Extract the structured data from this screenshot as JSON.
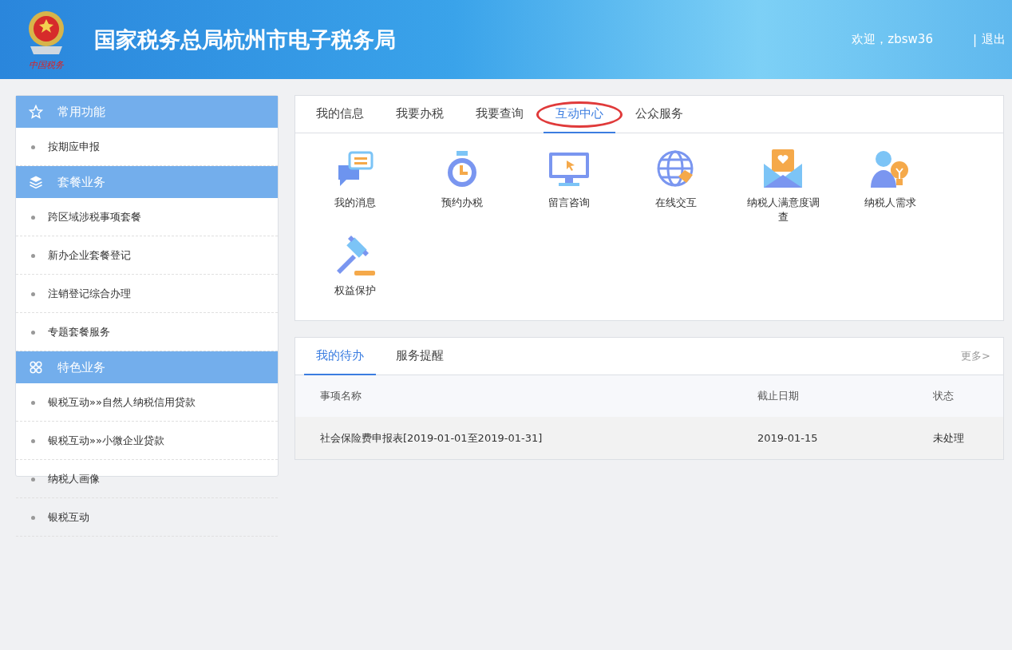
{
  "header": {
    "logo_text": "中国税务",
    "title": "国家税务总局杭州市电子税务局",
    "welcome": "欢迎，zbsw36",
    "separator": "|",
    "logout": "退出"
  },
  "sidebar": {
    "groups": [
      {
        "kind": "star",
        "title": "常用功能",
        "items": [
          "按期应申报"
        ]
      },
      {
        "kind": "layers",
        "title": "套餐业务",
        "items": [
          "跨区域涉税事项套餐",
          "新办企业套餐登记",
          "注销登记综合办理",
          "专题套餐服务"
        ]
      },
      {
        "kind": "grid",
        "title": "特色业务",
        "items": [
          "银税互动»»自然人纳税信用贷款",
          "银税互动»»小微企业贷款",
          "纳税人画像",
          "银税互动"
        ]
      }
    ]
  },
  "services": {
    "tabs": [
      {
        "label": "我的信息",
        "selected": false,
        "circled": false
      },
      {
        "label": "我要办税",
        "selected": false,
        "circled": false
      },
      {
        "label": "我要查询",
        "selected": false,
        "circled": false
      },
      {
        "label": "互动中心",
        "selected": true,
        "circled": true
      },
      {
        "label": "公众服务",
        "selected": false,
        "circled": false
      }
    ],
    "items": [
      {
        "kind": "message",
        "label": "我的消息"
      },
      {
        "kind": "timer",
        "label": "预约办税"
      },
      {
        "kind": "monitor",
        "label": "留言咨询"
      },
      {
        "kind": "globe",
        "label": "在线交互"
      },
      {
        "kind": "envelope",
        "label": "纳税人满意度调查"
      },
      {
        "kind": "person",
        "label": "纳税人需求"
      },
      {
        "kind": "gavel",
        "label": "权益保护"
      }
    ]
  },
  "todo": {
    "tabs": [
      {
        "label": "我的待办",
        "selected": true
      },
      {
        "label": "服务提醒",
        "selected": false
      }
    ],
    "more": "更多>",
    "columns": [
      "事项名称",
      "截止日期",
      "状态"
    ],
    "rows": [
      [
        "社会保险费申报表[2019-01-01至2019-01-31]",
        "2019-01-15",
        "未处理"
      ]
    ]
  }
}
